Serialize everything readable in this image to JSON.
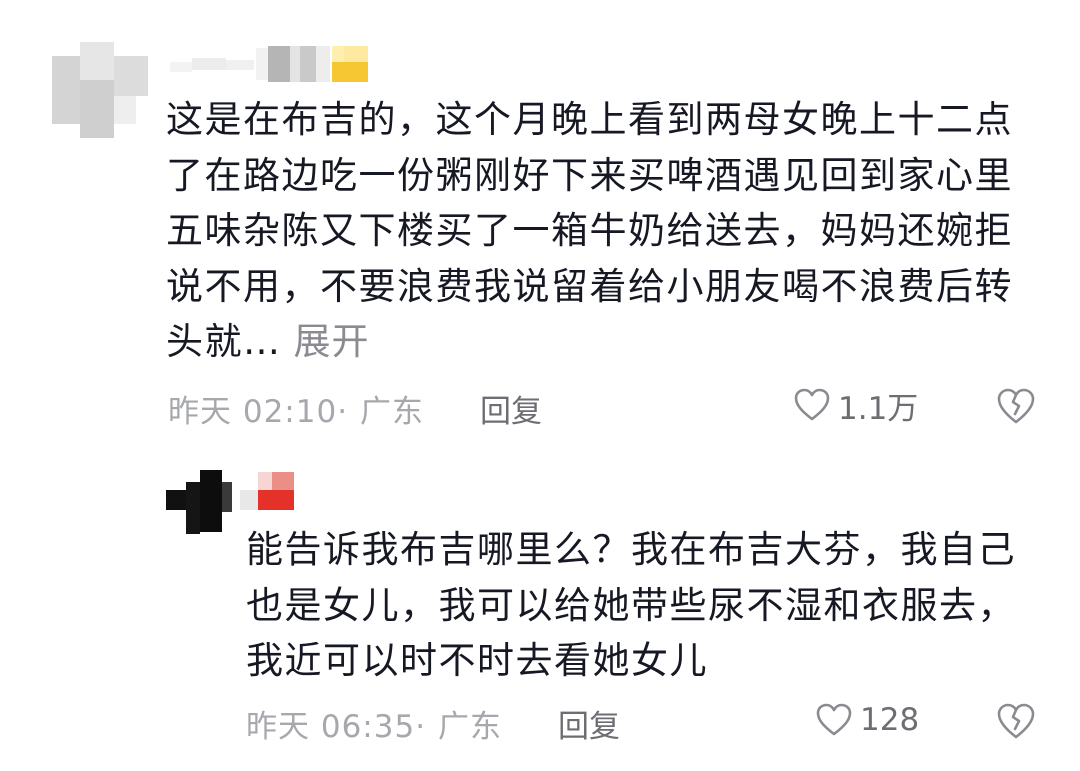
{
  "comments": [
    {
      "username": "",
      "text": "这是在布吉的，这个月晚上看到两母女晚上十二点了在路边吃一份粥刚好下来买啤酒遇见回到家心里五味杂陈又下楼买了一箱牛奶给送去，妈妈还婉拒说不用，不要浪费我说留着给小朋友喝不浪费后转头就…",
      "expand_label": "展开",
      "time": "昨天 02:10·",
      "location": "广东",
      "reply_label": "回复",
      "like_count": "1.1万",
      "icons": {
        "like": "heart-outline-icon",
        "dislike": "broken-heart-icon"
      }
    },
    {
      "username": "",
      "text": "能告诉我布吉哪里么？我在布吉大芬，我自己也是女儿，我可以给她带些尿不湿和衣服去，我近可以时不时去看她女儿",
      "time": "昨天 06:35·",
      "location": "广东",
      "reply_label": "回复",
      "like_count": "128",
      "icons": {
        "like": "heart-outline-icon",
        "dislike": "broken-heart-icon"
      }
    }
  ],
  "colors": {
    "text": "#161823",
    "secondary": "#a7a8ad",
    "action": "#6d6e74",
    "expand": "#8a8b91"
  }
}
